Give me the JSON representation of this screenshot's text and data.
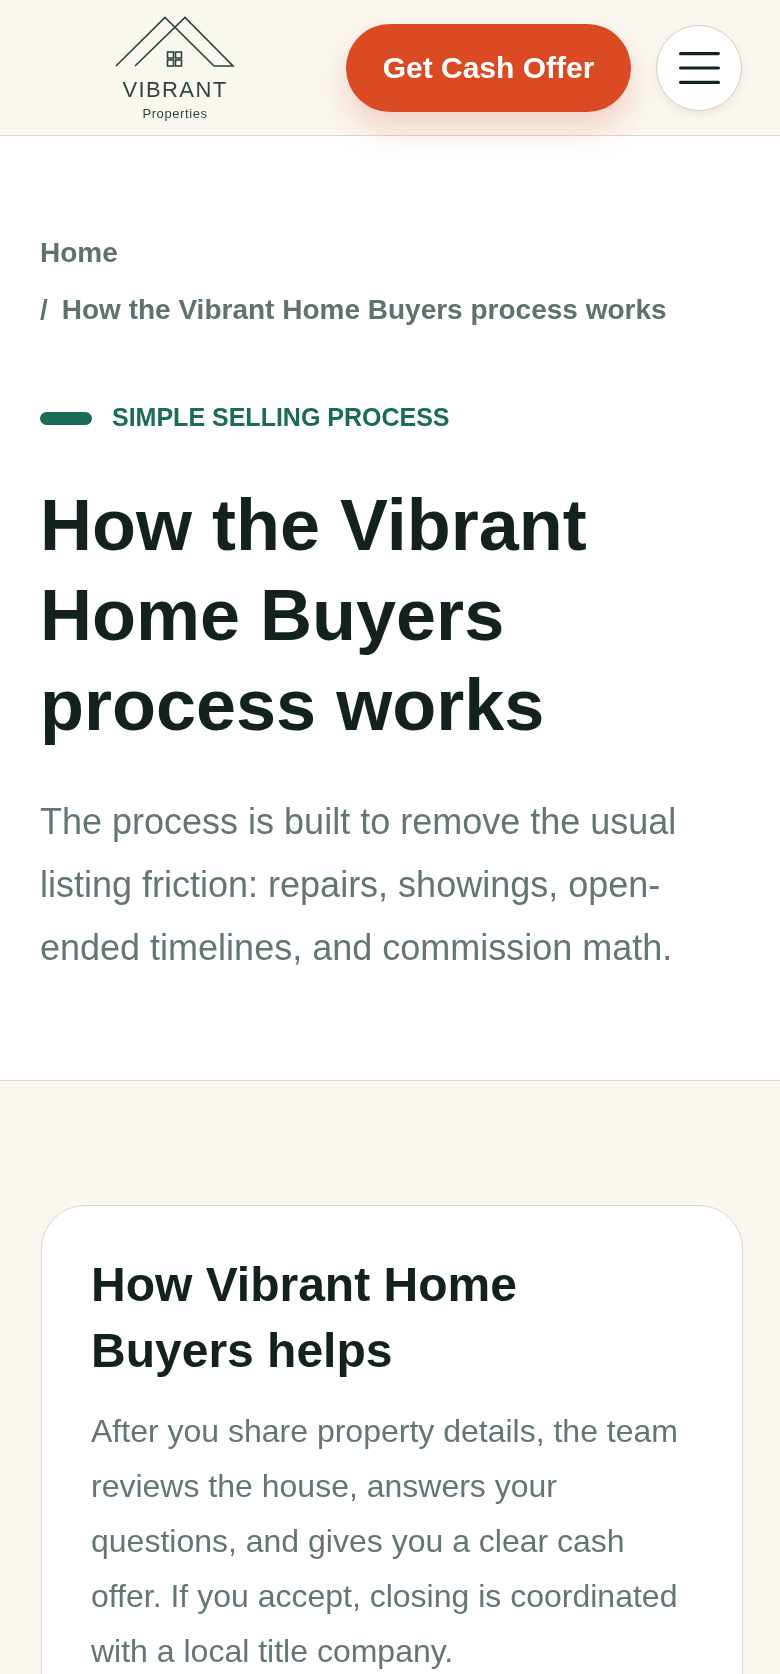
{
  "header": {
    "logo": {
      "name": "VIBRANT",
      "tagline": "Properties"
    },
    "cta_button": "Get Cash Offer"
  },
  "breadcrumb": {
    "separator": "/",
    "items": [
      "Home",
      "How the Vibrant Home Buyers process works"
    ]
  },
  "hero": {
    "eyebrow": "SIMPLE SELLING PROCESS",
    "title": "How the Vibrant Home Buyers process works",
    "lead": "The process is built to remove the usual listing friction: repairs, showings, open-ended timelines, and commission math."
  },
  "card": {
    "title": "How Vibrant Home Buyers helps",
    "body": "After you share property details, the team reviews the house, answers your questions, and gives you a clear cash offer. If you accept, closing is coordinated with a local title company."
  }
}
